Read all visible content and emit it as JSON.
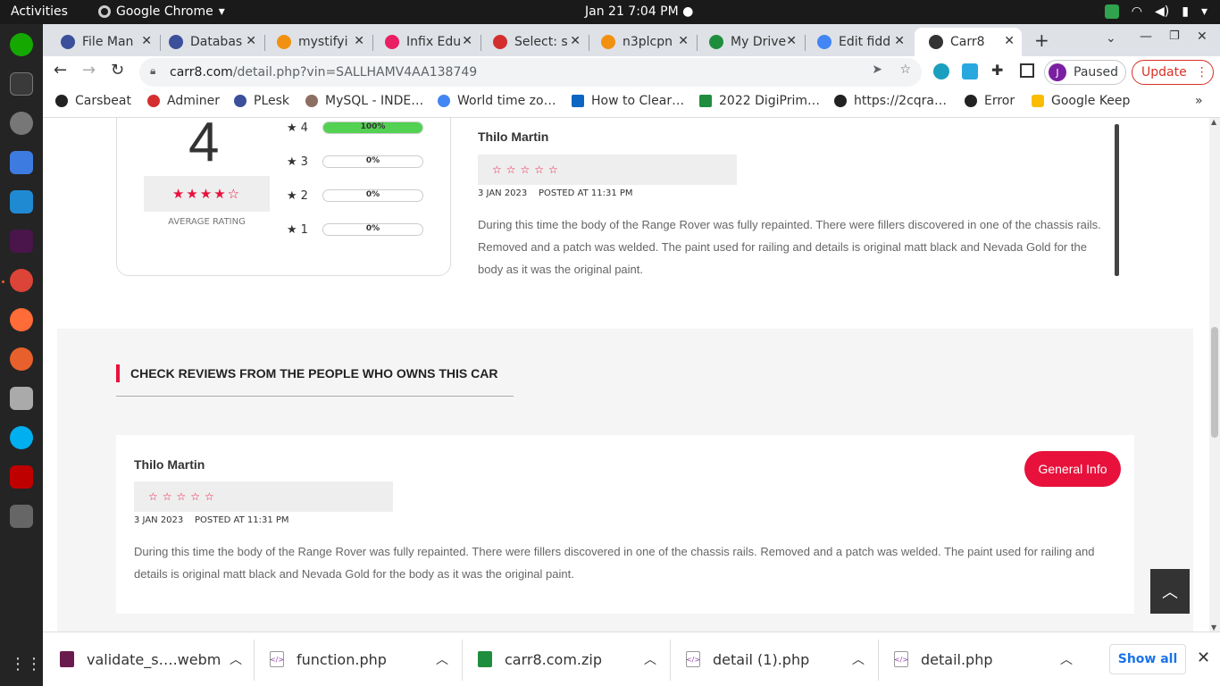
{
  "topbar": {
    "activities": "Activities",
    "app": "Google Chrome",
    "clock": "Jan 21  7:04 PM"
  },
  "tabs": [
    {
      "title": "File Man",
      "color": "#3c4f9a"
    },
    {
      "title": "Databas",
      "color": "#3c4f9a"
    },
    {
      "title": "mystifyi",
      "color": "#f29111"
    },
    {
      "title": "Infix Edu",
      "color": "#e91e63"
    },
    {
      "title": "Select: s",
      "color": "#d32f2f"
    },
    {
      "title": "n3plcpn",
      "color": "#f29111"
    },
    {
      "title": "My Drive",
      "color": "#1e8e3e"
    },
    {
      "title": "Edit fidd",
      "color": "#4285f4"
    },
    {
      "title": "Carr8",
      "color": "#333333"
    }
  ],
  "toolbar": {
    "url_host": "carr8.com",
    "url_path": "/detail.php?vin=SALLHAMV4AA138749",
    "profile_initial": "J",
    "profile_label": "Paused",
    "update_label": "Update"
  },
  "bookmarks": [
    {
      "label": "Carsbeat",
      "color": "#222222"
    },
    {
      "label": "Adminer",
      "color": "#d32f2f"
    },
    {
      "label": "PLesk",
      "color": "#3c4f9a"
    },
    {
      "label": "MySQL - INDE…",
      "color": "#8d6e63"
    },
    {
      "label": "World time zo…",
      "color": "#4285f4"
    },
    {
      "label": "How to Clear…",
      "color": "#0a66c2"
    },
    {
      "label": "2022 DigiPrim…",
      "color": "#1e8e3e"
    },
    {
      "label": "https://2cqra…",
      "color": "#222222"
    },
    {
      "label": "Error",
      "color": "#222222"
    },
    {
      "label": "Google Keep",
      "color": "#fbbc04"
    }
  ],
  "rating": {
    "average": "4",
    "average_stars": "★★★★☆",
    "average_label": "AVERAGE RATING",
    "breakdown": [
      {
        "star": "4",
        "pct_label": "100%",
        "fraction": 1.0
      },
      {
        "star": "3",
        "pct_label": "0%",
        "fraction": 0
      },
      {
        "star": "2",
        "pct_label": "0%",
        "fraction": 0
      },
      {
        "star": "1",
        "pct_label": "0%",
        "fraction": 0
      }
    ]
  },
  "top_review": {
    "name": "Thilo Martin",
    "stars": "☆☆☆☆☆",
    "date": "3 JAN 2023",
    "posted": "POSTED AT 11:31 PM",
    "body": "During this time the body of the Range Rover was fully repainted. There were fillers discovered in one of the chassis rails. Removed and a patch was welded. The paint used for railing and details is original matt black and Nevada Gold for the body as it was the original paint."
  },
  "section": {
    "title": "CHECK REVIEWS FROM THE PEOPLE WHO OWNS THIS CAR"
  },
  "owner_review": {
    "name": "Thilo Martin",
    "stars": "☆☆☆☆☆",
    "date": "3 JAN 2023",
    "posted": "POSTED AT 11:31 PM",
    "body": "During this time the body of the Range Rover was fully repainted. There were fillers discovered in one of the chassis rails. Removed and a patch was welded. The paint used for railing and details is original matt black and Nevada Gold for the body as it was the original paint.",
    "button": "General Info"
  },
  "downloads": {
    "items": [
      "validate_s….webm",
      "function.php",
      "carr8.com.zip",
      "detail (1).php",
      "detail.php"
    ],
    "show_all": "Show all"
  },
  "colors": {
    "accent": "#e8113c",
    "bar_fill": "#52d152"
  }
}
